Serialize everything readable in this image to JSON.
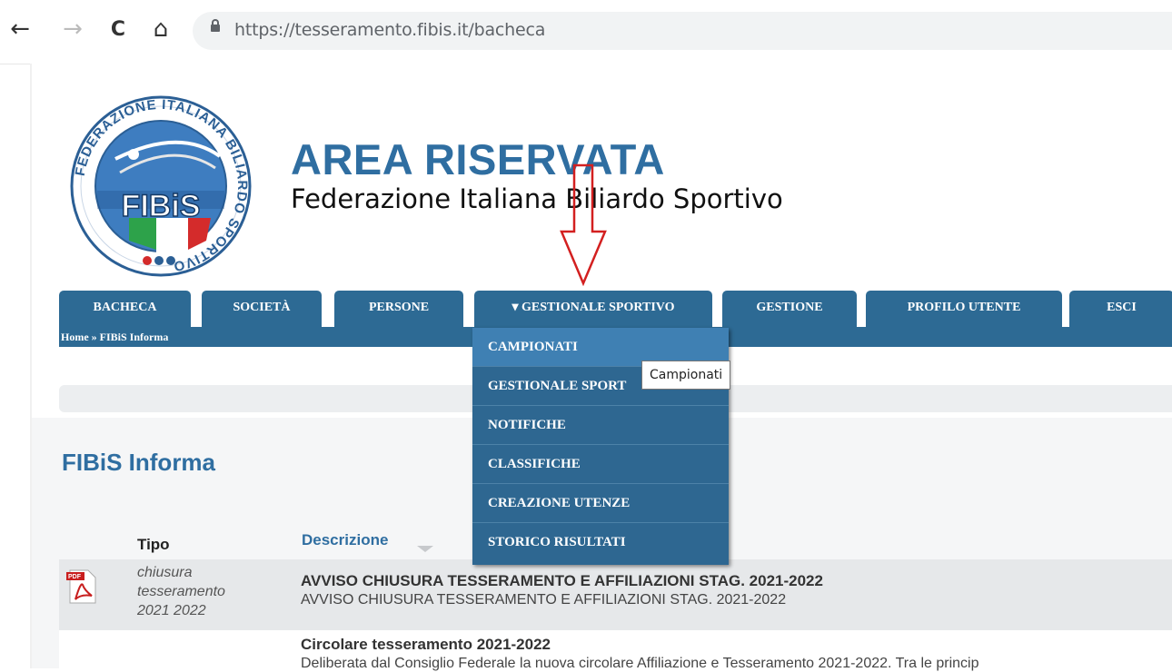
{
  "browser": {
    "url": "https://tesseramento.fibis.it/bacheca",
    "back_icon": "←",
    "forward_icon": "→",
    "reload_icon": "C",
    "home_icon": "⌂"
  },
  "header": {
    "title": "AREA RISERVATA",
    "subtitle": "Federazione Italiana Biliardo Sportivo",
    "logo_text": "FIBiS",
    "logo_ring_text": "FEDERAZIONE ITALIANA BILIARDO SPORTIVO"
  },
  "tabs": [
    {
      "label": "BACHECA"
    },
    {
      "label": "SOCIETÀ"
    },
    {
      "label": "PERSONE"
    },
    {
      "label": "▾ GESTIONALE SPORTIVO"
    },
    {
      "label": "GESTIONE"
    },
    {
      "label": "PROFILO UTENTE"
    },
    {
      "label": "ESCI"
    }
  ],
  "breadcrumb": "Home » FIBiS Informa",
  "dropdown": {
    "items": [
      {
        "label": "CAMPIONATI"
      },
      {
        "label": "GESTIONALE SPORT"
      },
      {
        "label": "NOTIFICHE"
      },
      {
        "label": "CLASSIFICHE"
      },
      {
        "label": "CREAZIONE UTENZE"
      },
      {
        "label": "STORICO RISULTATI"
      }
    ],
    "tooltip": "Campionati"
  },
  "main": {
    "section_title": "FIBiS Informa",
    "columns": {
      "tipo": "Tipo",
      "descrizione": "Descrizione"
    },
    "rows": [
      {
        "tipo_lines": [
          "chiusura",
          "tesseramento",
          "2021 2022"
        ],
        "title": "AVVISO CHIUSURA TESSERAMENTO E AFFILIAZIONI STAG. 2021-2022",
        "subtitle": "AVVISO CHIUSURA TESSERAMENTO E AFFILIAZIONI STAG. 2021-2022"
      },
      {
        "title": "Circolare tesseramento 2021-2022",
        "subtitle": "Deliberata dal Consiglio Federale la nuova circolare Affiliazione e Tesseramento 2021-2022. Tra le princip"
      }
    ]
  },
  "colors": {
    "brand_blue": "#2d6a94",
    "title_blue": "#2f6ea1",
    "arrow_red": "#d32020"
  }
}
